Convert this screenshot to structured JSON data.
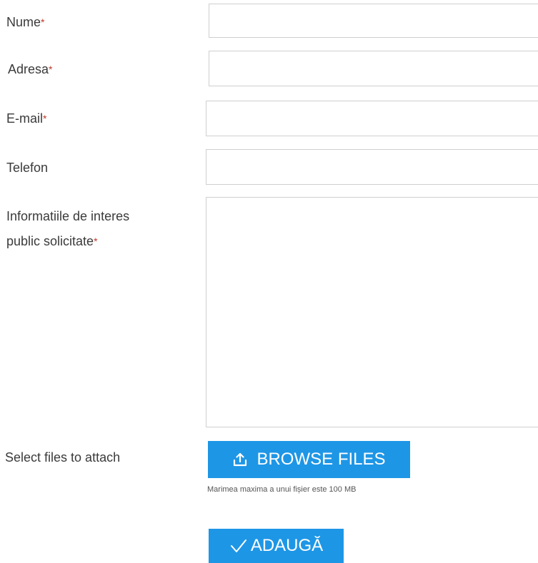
{
  "form": {
    "fields": {
      "nume": {
        "label": "Nume",
        "required_mark": "*",
        "value": ""
      },
      "adresa": {
        "label": "Adresa",
        "required_mark": "*",
        "value": ""
      },
      "email": {
        "label": "E-mail",
        "required_mark": "*",
        "value": ""
      },
      "telefon": {
        "label": "Telefon",
        "value": ""
      },
      "informatii": {
        "label_line1": "Informatiile de interes",
        "label_line2": "public solicitate",
        "required_mark": "*",
        "value": ""
      }
    },
    "attach": {
      "label": "Select files to attach",
      "browse_label": "BROWSE FILES",
      "browse_icon": "upload-icon",
      "hint": "Marimea maxima a unui fișier este 100 MB"
    },
    "submit": {
      "label": "ADAUGĂ",
      "icon": "checkmark-icon"
    }
  },
  "colors": {
    "accent": "#1e96e6",
    "required": "#c0392b",
    "border": "#cfcfcf"
  }
}
